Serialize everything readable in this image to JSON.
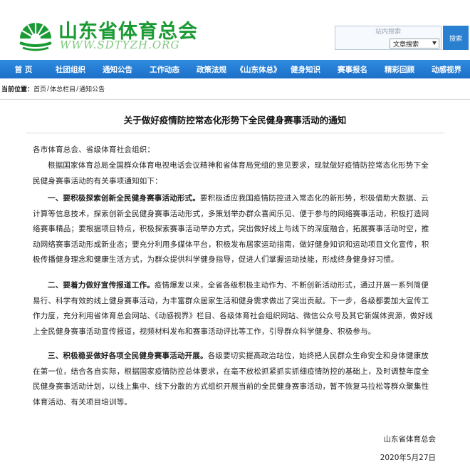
{
  "header": {
    "site_title": "山东省体育总会",
    "site_url": "WWW.SDTYZH.ORG",
    "colors": {
      "brand_green": "#1a9a33",
      "nav_blue": "#1f75cd"
    }
  },
  "search": {
    "placeholder": "站内搜索",
    "scope_value": "文章搜索",
    "button_label": "搜索"
  },
  "nav": {
    "items": [
      "首 页",
      "社团组织",
      "通知公告",
      "工作动态",
      "政策法规",
      "《山东体总》",
      "健身知识",
      "赛事报名",
      "精彩回顾",
      "动感视界"
    ]
  },
  "breadcrumb": {
    "prefix": "当前位置：",
    "home": "首页",
    "sep": "/",
    "section": "体总栏目",
    "current": "通知公告"
  },
  "article": {
    "title": "关于做好疫情防控常态化形势下全民健身赛事活动的通知",
    "salutation": "各市体育总会、省级体育社会组织：",
    "intro": "根据国家体育总局全国群众体育电视电话会议精神和省体育局党组的意见要求，现就做好疫情防控常态化形势下全民健身赛事活动的有关事项通知如下：",
    "sections": [
      {
        "heading": "一、要积极探索创新全民健身赛事活动形式。",
        "text": "要积极适应我国疫情防控进入常态化的新形势，积极借助大数据、云计算等信息技术，探索创新全民健身赛事活动形式，多策划举办群众喜闻乐见、便于参与的网络赛事活动，积极打造网络赛事精品；要根据项目特点，积极探索赛事活动举办方式，突出做好线上与线下的深度融合，拓展赛事活动时空，推动网络赛事活动形成新业态；要充分利用多媒体平台，积极发布居家运动指南，做好健身知识和运动项目文化宣传，积极传播健身理念和健康生活方式，为群众提供科学健身指导，促进人们掌握运动技能，形成终身健身好习惯。"
      },
      {
        "heading": "二、要着力做好宣传报道工作。",
        "text": "疫情爆发以来，全省各级积极主动作为、不断创新活动形式，通过开展一系列简便易行、科学有效的线上健身赛事活动，为丰富群众居家生活和健身需求做出了突出贡献。下一步，各级都要加大宣传工作力度，充分利用省体育总会网站、《动感视界》栏目、各级体育社会组织网站、微信公众号及其它新媒体资源，做好线上全民健身赛事活动宣传报道，视频材料发布和赛事活动评比等工作，引导群众科学健身、积极参与。"
      },
      {
        "heading": "三、积极稳妥做好各项全民健身赛事活动开展。",
        "text": "各级要切实提高政治站位，始终把人民群众生命安全和身体健康放在第一位，结合各自实际，根据国家疫情防控总体要求，在毫不放松抓紧抓实抓细疫情防控的基础上，及时调整年度全民健身赛事活动计划，以线上集中、线下分散的方式组织开展当前的全民健身赛事活动，暂不恢复马拉松等群众聚集性体育活动、有关项目培训等。"
      }
    ],
    "signature": "山东省体育总会",
    "date": "2020年5月27日"
  }
}
